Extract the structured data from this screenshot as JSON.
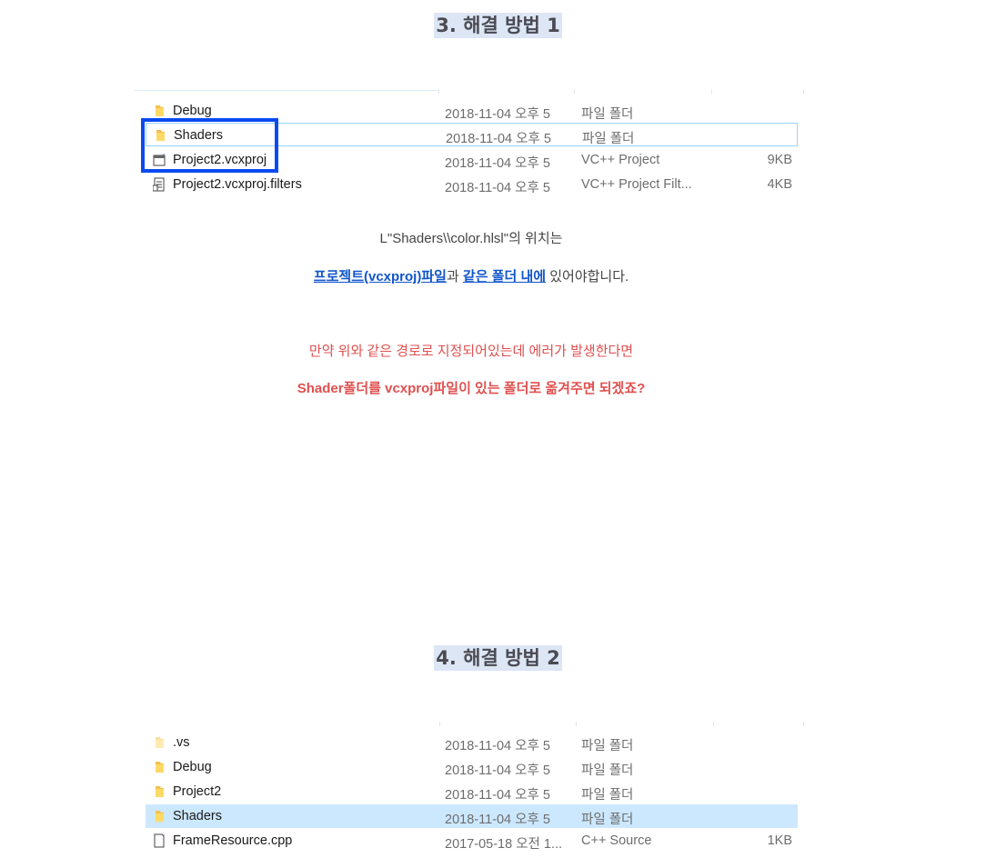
{
  "section3": {
    "heading": "3. 해결 방법 1",
    "files": [
      {
        "name": "Debug",
        "date": "2018-11-04 오후 5",
        "type": "파일 폴더",
        "size": "",
        "icon": "folder-icon"
      },
      {
        "name": "Shaders",
        "date": "2018-11-04 오후 5",
        "type": "파일 폴더",
        "size": "",
        "icon": "folder-icon"
      },
      {
        "name": "Project2.vcxproj",
        "date": "2018-11-04 오후 5",
        "type": "VC++ Project",
        "size": "9KB",
        "icon": "vcxproj-icon"
      },
      {
        "name": "Project2.vcxproj.filters",
        "date": "2018-11-04 오후 5",
        "type": "VC++ Project Filt...",
        "size": "4KB",
        "icon": "filters-file-icon"
      }
    ],
    "line1": "L\"Shaders\\\\color.hlsl\"의 위치는",
    "line2_link1": "프로젝트(vcxproj)파일",
    "line2_mid": "과 ",
    "line2_link2": "같은 폴더 내에",
    "line2_end": " 있어야합니다.",
    "warn1": "만약 위와 같은 경로로 지정되어있는데 에러가 발생한다면",
    "warn2": "Shader폴더를 vcxproj파일이 있는 폴더로 옮겨주면 되겠죠?"
  },
  "section4": {
    "heading": "4. 해결 방법 2",
    "files": [
      {
        "name": ".vs",
        "date": "2018-11-04 오후 5",
        "type": "파일 폴더",
        "size": "",
        "icon": "folder-icon"
      },
      {
        "name": "Debug",
        "date": "2018-11-04 오후 5",
        "type": "파일 폴더",
        "size": "",
        "icon": "folder-icon"
      },
      {
        "name": "Project2",
        "date": "2018-11-04 오후 5",
        "type": "파일 폴더",
        "size": "",
        "icon": "folder-icon"
      },
      {
        "name": "Shaders",
        "date": "2018-11-04 오후 5",
        "type": "파일 폴더",
        "size": "",
        "icon": "folder-icon"
      },
      {
        "name": "FrameResource.cpp",
        "date": "2017-05-18 오전 1...",
        "type": "C++ Source",
        "size": "1KB",
        "icon": "cpp-file-icon"
      }
    ]
  },
  "colors": {
    "highlight_box": "#0a4af0",
    "selected_row": "#cce8ff",
    "warning_text": "#e05050",
    "link": "#1155cc"
  }
}
